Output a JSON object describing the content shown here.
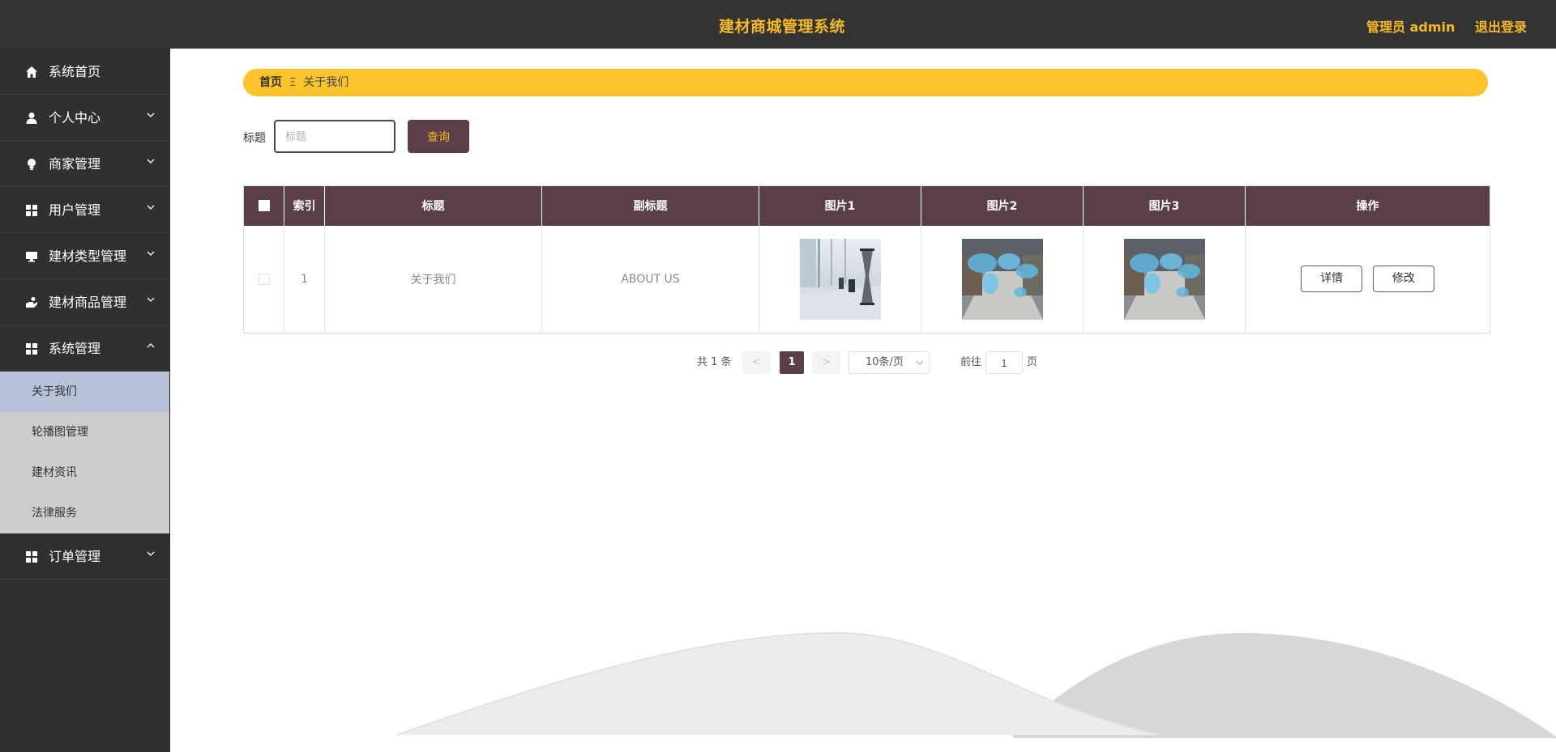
{
  "header": {
    "title": "建材商城管理系统",
    "admin": "管理员 admin",
    "logout": "退出登录"
  },
  "sidebar": {
    "items": [
      {
        "label": "系统首页",
        "icon": "home-icon"
      },
      {
        "label": "个人中心",
        "icon": "user-icon"
      },
      {
        "label": "商家管理",
        "icon": "bulb-icon"
      },
      {
        "label": "用户管理",
        "icon": "grid-icon"
      },
      {
        "label": "建材类型管理",
        "icon": "monitor-icon"
      },
      {
        "label": "建材商品管理",
        "icon": "hand-icon"
      },
      {
        "label": "系统管理",
        "icon": "grid-icon"
      },
      {
        "label": "订单管理",
        "icon": "grid-icon"
      }
    ],
    "system_submenu": [
      {
        "label": "关于我们",
        "active": true
      },
      {
        "label": "轮播图管理",
        "active": false
      },
      {
        "label": "建材资讯",
        "active": false
      },
      {
        "label": "法律服务",
        "active": false
      }
    ]
  },
  "breadcrumb": {
    "home": "首页",
    "separator": "Ξ",
    "current": "关于我们"
  },
  "search": {
    "label": "标题",
    "placeholder": "标题",
    "button": "查询"
  },
  "table": {
    "headers": [
      "索引",
      "标题",
      "副标题",
      "图片1",
      "图片2",
      "图片3",
      "操作"
    ],
    "rows": [
      {
        "index": "1",
        "title": "关于我们",
        "subtitle": "ABOUT US",
        "image1": "meeting-room-hourglass-image",
        "image2": "warehouse-world-map-image",
        "image3": "warehouse-world-map-image",
        "actions": [
          "详情",
          "修改"
        ]
      }
    ]
  },
  "pagination": {
    "total": "共 1 条",
    "prev": "<",
    "next": ">",
    "current_page": "1",
    "page_size": "10条/页",
    "goto_label": "前往",
    "goto_value": "1",
    "goto_unit": "页"
  },
  "colors": {
    "header_bg": "#333333",
    "accent": "#f5b921",
    "breadcrumb_bg": "#fbc42a",
    "primary": "#5b3f48",
    "submenu_active": "#b7c1d8"
  }
}
